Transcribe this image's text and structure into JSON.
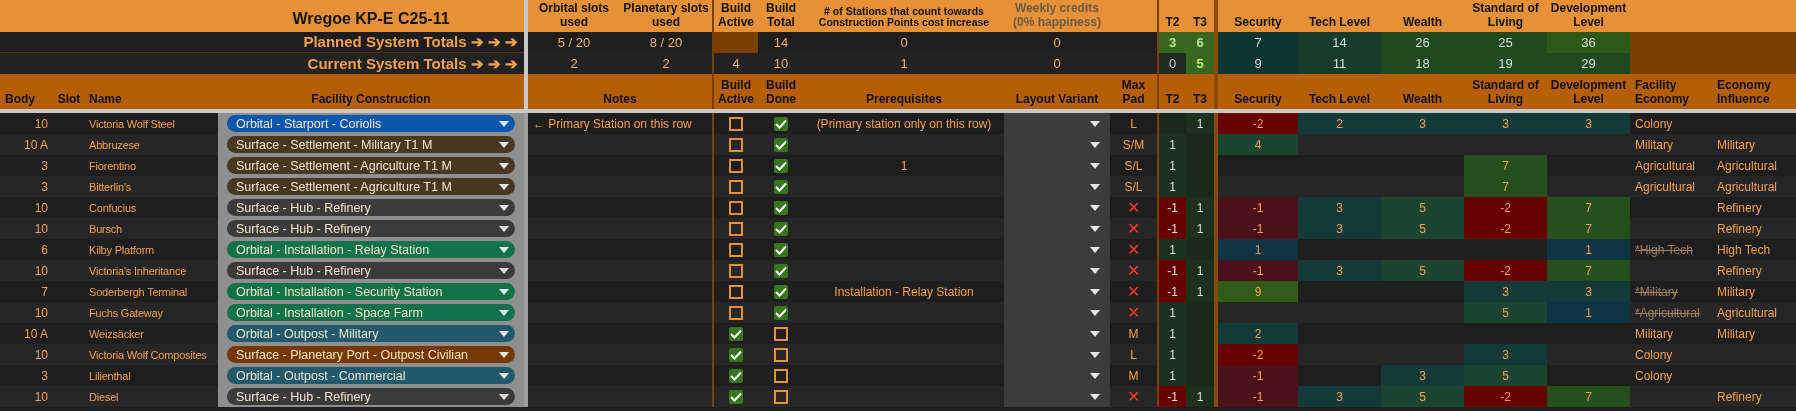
{
  "sheet": {
    "title": "Wregoe KP-E C25-11"
  },
  "summary_headers": [
    "Orbital slots used",
    "Planetary slots used",
    "Build Active",
    "Build Total",
    "# of Stations that count towards Construction Points cost increase",
    "Weekly credits (0% happiness)",
    "T2",
    "T3",
    "Security",
    "Tech Level",
    "Wealth",
    "Standard of Living",
    "Development Level"
  ],
  "totals": [
    {
      "label": "Planned System Totals ➔ ➔ ➔",
      "orbital_slots": "5 / 20",
      "planetary_slots": "8 / 20",
      "build_total": "14",
      "stations": "0",
      "weekly_credits": "0",
      "t2": "3",
      "t3": "6",
      "security": "7",
      "tech_level": "14",
      "wealth": "26",
      "standard_of_living": "25",
      "development_level": "36"
    },
    {
      "label": "Current System Totals ➔ ➔ ➔",
      "orbital_slots": "2",
      "planetary_slots": "2",
      "build_active": "4",
      "build_total": "10",
      "stations": "1",
      "weekly_credits": "0",
      "t2": "0",
      "t3": "5",
      "security": "9",
      "tech_level": "11",
      "wealth": "18",
      "standard_of_living": "19",
      "development_level": "29"
    }
  ],
  "columns": [
    "Body",
    "Slot",
    "Name",
    "Facility Construction",
    "Notes",
    "Build Active",
    "Build Done",
    "Prerequisites",
    "Layout Variant",
    "Max Pad",
    "T2",
    "T3",
    "Security",
    "Tech Level",
    "Wealth",
    "Standard of Living",
    "Development Level",
    "Facility Economy",
    "Economy Influence"
  ],
  "rows": [
    {
      "body": "10",
      "name": "Victoria Wolf Steel",
      "facility": {
        "text": "Orbital - Starport - Coriolis",
        "color": "#0b57ad"
      },
      "notes": "← Primary Station on this row",
      "build_active": false,
      "build_done": true,
      "prerequisites": "(Primary station only on this row)",
      "max_pad": "L",
      "pad_allowed": true,
      "t3": "1",
      "security": "-2",
      "tech_level": "2",
      "wealth": "3",
      "standard_of_living": "3",
      "development_level": "3",
      "facility_economy": {
        "text": "Colony",
        "struck": false
      }
    },
    {
      "body": "10 A",
      "name": "Abbruzese",
      "facility": {
        "text": "Surface - Settlement - Military T1 M",
        "color": "#473821"
      },
      "build_active": false,
      "build_done": true,
      "max_pad": "S/M",
      "pad_allowed": true,
      "t2": "1",
      "security": "4",
      "facility_economy": {
        "text": "Military",
        "struck": false
      },
      "economy_influence": "Military"
    },
    {
      "body": "3",
      "name": "Fiorentino",
      "facility": {
        "text": "Surface - Settlement - Agriculture T1 M",
        "color": "#473821"
      },
      "build_active": false,
      "build_done": true,
      "prerequisites": "1",
      "max_pad": "S/L",
      "pad_allowed": true,
      "t2": "1",
      "standard_of_living": "7",
      "facility_economy": {
        "text": "Agricultural",
        "struck": false
      },
      "economy_influence": "Agricultural"
    },
    {
      "body": "3",
      "name": "Bitterlin's",
      "facility": {
        "text": "Surface - Settlement - Agriculture T1 M",
        "color": "#473821"
      },
      "build_active": false,
      "build_done": true,
      "max_pad": "S/L",
      "pad_allowed": true,
      "t2": "1",
      "standard_of_living": "7",
      "facility_economy": {
        "text": "Agricultural",
        "struck": false
      },
      "economy_influence": "Agricultural"
    },
    {
      "body": "10",
      "name": "Confucius",
      "facility": {
        "text": "Surface - Hub - Refinery",
        "color": "#3b3b3b"
      },
      "build_active": false,
      "build_done": true,
      "max_pad": "✕",
      "pad_allowed": false,
      "t2": "-1",
      "t3": "1",
      "security": "-1",
      "tech_level": "3",
      "wealth": "5",
      "standard_of_living": "-2",
      "development_level": "7",
      "economy_influence": "Refinery"
    },
    {
      "body": "10",
      "name": "Bursch",
      "facility": {
        "text": "Surface - Hub - Refinery",
        "color": "#3b3b3b"
      },
      "build_active": false,
      "build_done": true,
      "max_pad": "✕",
      "pad_allowed": false,
      "t2": "-1",
      "t3": "1",
      "security": "-1",
      "tech_level": "3",
      "wealth": "5",
      "standard_of_living": "-2",
      "development_level": "7",
      "economy_influence": "Refinery"
    },
    {
      "body": "6",
      "name": "Kilby Platform",
      "facility": {
        "text": "Orbital - Installation - Relay Station",
        "color": "#12734b"
      },
      "build_active": false,
      "build_done": true,
      "max_pad": "✕",
      "pad_allowed": false,
      "t2": "1",
      "security": "1",
      "development_level": "1",
      "facility_economy": {
        "text": "*High Tech",
        "struck": true
      },
      "economy_influence": "High Tech"
    },
    {
      "body": "10",
      "name": "Victoria's Inheritance",
      "facility": {
        "text": "Surface - Hub - Refinery",
        "color": "#3b3b3b"
      },
      "build_active": false,
      "build_done": true,
      "max_pad": "✕",
      "pad_allowed": false,
      "t2": "-1",
      "t3": "1",
      "security": "-1",
      "tech_level": "3",
      "wealth": "5",
      "standard_of_living": "-2",
      "development_level": "7",
      "economy_influence": "Refinery"
    },
    {
      "body": "7",
      "name": "Soderbergh Terminal",
      "facility": {
        "text": "Orbital - Installation - Security Station",
        "color": "#12734b"
      },
      "build_active": false,
      "build_done": true,
      "prerequisites": "Installation - Relay Station",
      "max_pad": "✕",
      "pad_allowed": false,
      "t2": "-1",
      "t3": "1",
      "security": "9",
      "standard_of_living": "3",
      "development_level": "3",
      "facility_economy": {
        "text": "*Military",
        "struck": true
      },
      "economy_influence": "Military"
    },
    {
      "body": "10",
      "name": "Fuchs Gateway",
      "facility": {
        "text": "Orbital - Installation - Space Farm",
        "color": "#12734b"
      },
      "build_active": false,
      "build_done": true,
      "max_pad": "✕",
      "pad_allowed": false,
      "t2": "1",
      "standard_of_living": "5",
      "development_level": "1",
      "facility_economy": {
        "text": "*Agricultural",
        "struck": true
      },
      "economy_influence": "Agricultural"
    },
    {
      "body": "10 A",
      "name": "Weizsäcker",
      "facility": {
        "text": "Orbital - Outpost - Military",
        "color": "#215a6c"
      },
      "build_active": true,
      "build_done": false,
      "max_pad": "M",
      "pad_allowed": true,
      "t2": "1",
      "security": "2",
      "facility_economy": {
        "text": "Military",
        "struck": false
      },
      "economy_influence": "Military"
    },
    {
      "body": "10",
      "name": "Victoria Wolf Composites",
      "facility": {
        "text": "Surface - Planetary Port - Outpost Civilian",
        "color": "#753800"
      },
      "build_active": true,
      "build_done": false,
      "max_pad": "L",
      "pad_allowed": true,
      "t2": "1",
      "security": "-2",
      "standard_of_living": "3",
      "facility_economy": {
        "text": "Colony",
        "struck": false
      }
    },
    {
      "body": "3",
      "name": "Lilienthal",
      "facility": {
        "text": "Orbital - Outpost - Commercial",
        "color": "#215a6c"
      },
      "build_active": true,
      "build_done": false,
      "max_pad": "M",
      "pad_allowed": true,
      "t2": "1",
      "security": "-1",
      "wealth": "3",
      "standard_of_living": "5",
      "facility_economy": {
        "text": "Colony",
        "struck": false
      }
    },
    {
      "body": "10",
      "name": "Diesel",
      "facility": {
        "text": "Surface - Hub - Refinery",
        "color": "#3b3b3b"
      },
      "build_active": true,
      "build_done": false,
      "max_pad": "✕",
      "pad_allowed": false,
      "t2": "-1",
      "t3": "1",
      "security": "-1",
      "tech_level": "3",
      "wealth": "5",
      "standard_of_living": "-2",
      "development_level": "7",
      "economy_influence": "Refinery"
    }
  ]
}
